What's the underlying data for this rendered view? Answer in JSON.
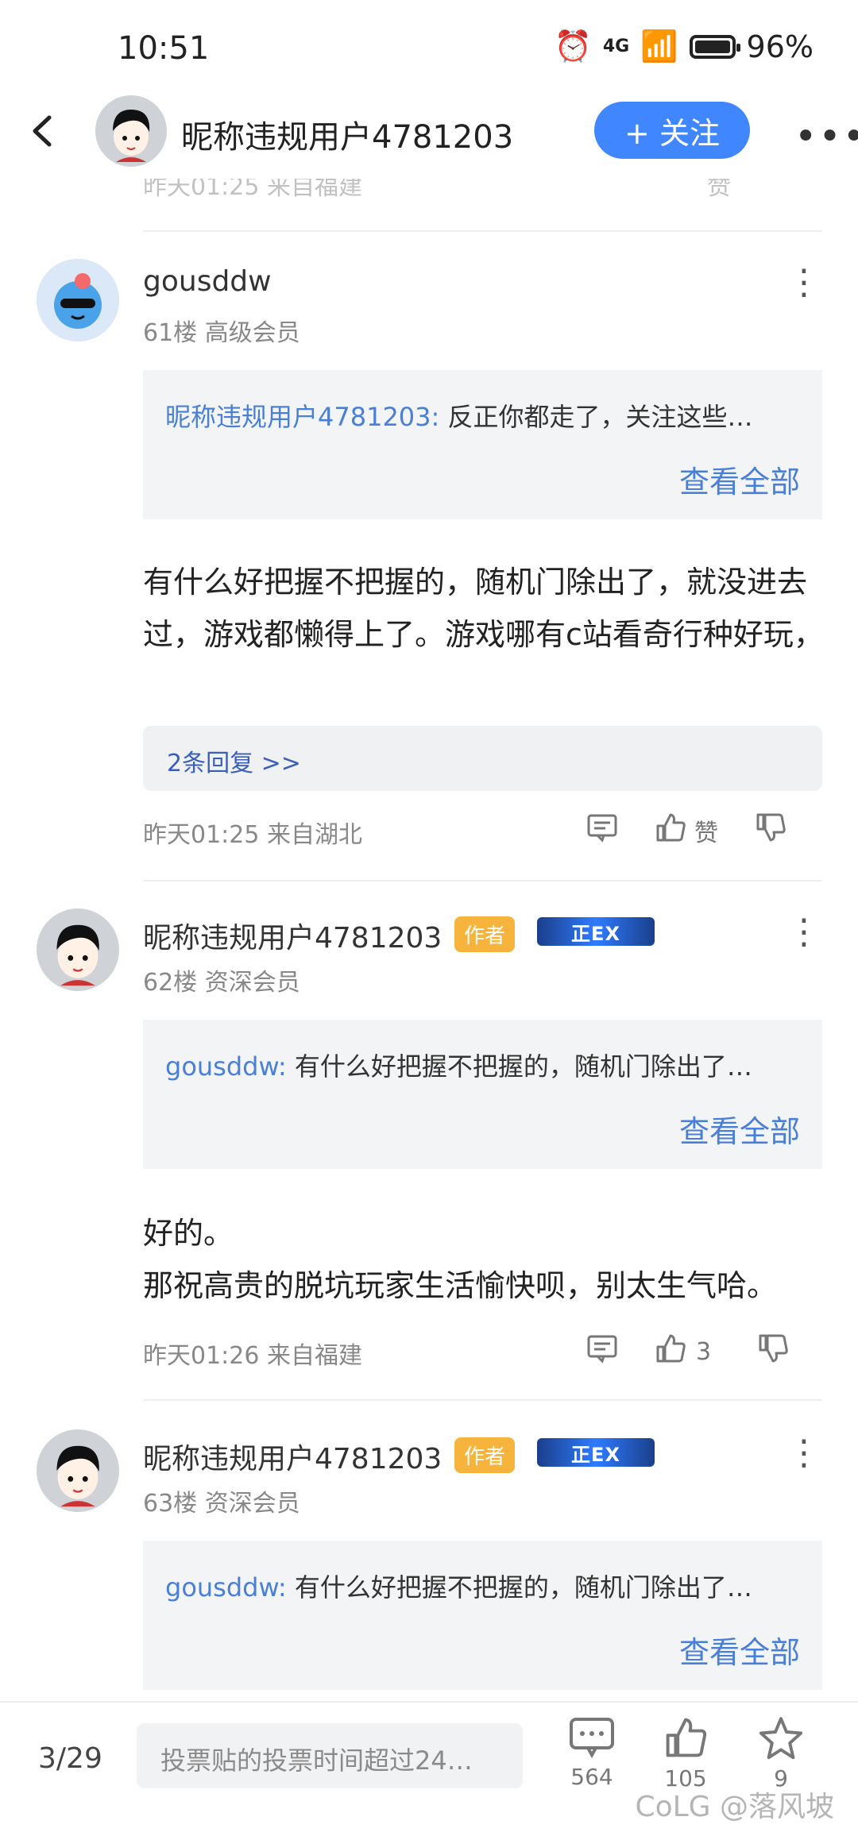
{
  "status_bar": {
    "time": "10:51",
    "network": "4G",
    "battery": "96%"
  },
  "header": {
    "back_icon": "back-arrow",
    "user_name": "昵称违规用户4781203",
    "follow_label": "+ 关注"
  },
  "previous_row": {
    "meta": "昨天01:25 来自福建",
    "like_label": "赞"
  },
  "comments": [
    {
      "user": "gousddw",
      "floor": "61楼 高级会员",
      "quote_user": "昵称违规用户4781203:",
      "quote_text": "反正你都走了，关注这些…",
      "quote_view_all": "查看全部",
      "text": "有什么好把握不把握的，随机门除出了，就没进去过，游戏都懒得上了。游戏哪有c站看奇行种好玩，",
      "replies": "2条回复 >>",
      "meta": "昨天01:25 来自湖北",
      "like": "赞"
    },
    {
      "user": "昵称违规用户4781203",
      "badge_author": "作者",
      "badge_level": "正EX",
      "floor": "62楼 资深会员",
      "quote_user": "gousddw:",
      "quote_text": "有什么好把握不把握的，随机门除出了…",
      "quote_view_all": "查看全部",
      "text_line1": "好的。",
      "text_line2": "那祝高贵的脱坑玩家生活愉快呗，别太生气哈。",
      "meta": "昨天01:26 来自福建",
      "like": "3"
    },
    {
      "user": "昵称违规用户4781203",
      "badge_author": "作者",
      "badge_level": "正EX",
      "floor": "63楼 资深会员",
      "quote_user": "gousddw:",
      "quote_text": "有什么好把握不把握的，随机门除出了…",
      "quote_view_all": "查看全部"
    }
  ],
  "bottom_bar": {
    "page": "3/29",
    "input_placeholder": "投票贴的投票时间超过24…",
    "comments_count": "564",
    "likes_count": "105",
    "favorites_count": "9",
    "watermark": "CoLG @落风坡"
  },
  "colors": {
    "accent": "#3f86ff",
    "link": "#4a7fd6",
    "author_badge": "#f7b43c"
  }
}
